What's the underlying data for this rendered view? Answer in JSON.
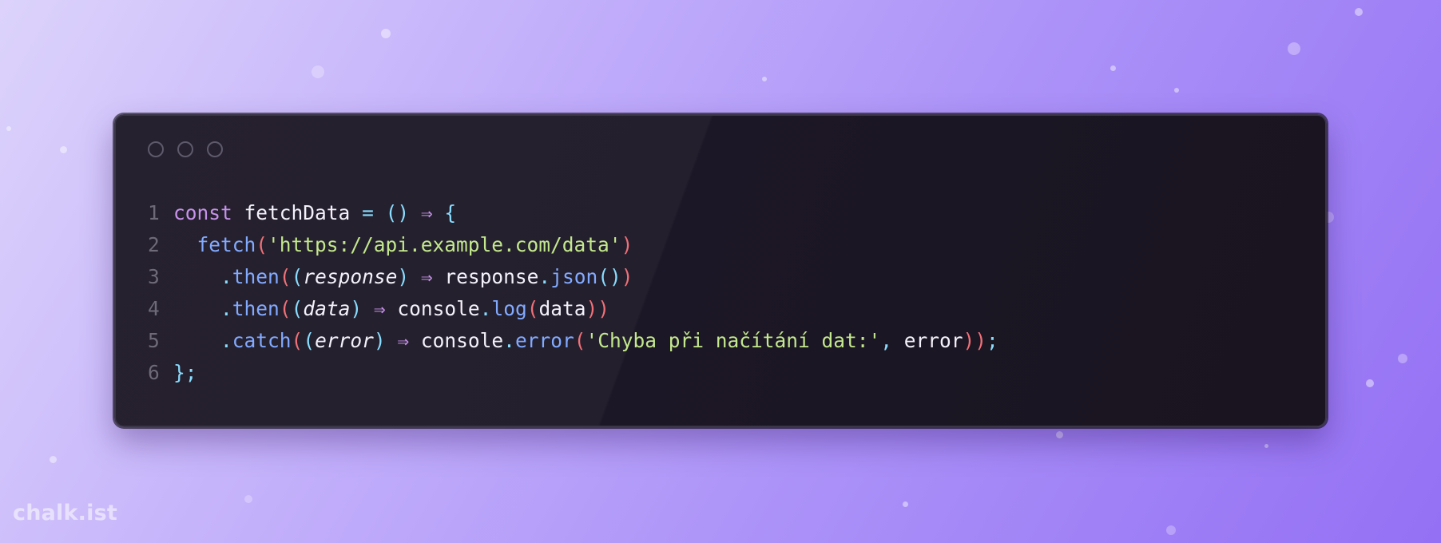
{
  "window": {
    "controls": [
      "window-dot",
      "window-dot",
      "window-dot"
    ]
  },
  "code": {
    "lines": [
      {
        "number": "1",
        "tokens": [
          {
            "t": "const",
            "c": "kw"
          },
          {
            "t": " ",
            "c": "id"
          },
          {
            "t": "fetchData",
            "c": "id"
          },
          {
            "t": " ",
            "c": "id"
          },
          {
            "t": "=",
            "c": "op"
          },
          {
            "t": " ",
            "c": "id"
          },
          {
            "t": "()",
            "c": "op"
          },
          {
            "t": " ",
            "c": "id"
          },
          {
            "t": "⇒",
            "c": "ar"
          },
          {
            "t": " ",
            "c": "id"
          },
          {
            "t": "{",
            "c": "op"
          }
        ]
      },
      {
        "number": "2",
        "tokens": [
          {
            "t": "  ",
            "c": "id"
          },
          {
            "t": "fetch",
            "c": "fn"
          },
          {
            "t": "(",
            "c": "pr"
          },
          {
            "t": "'https://api.example.com/data'",
            "c": "st"
          },
          {
            "t": ")",
            "c": "pr"
          }
        ]
      },
      {
        "number": "3",
        "tokens": [
          {
            "t": "    ",
            "c": "id"
          },
          {
            "t": ".",
            "c": "op"
          },
          {
            "t": "then",
            "c": "fn"
          },
          {
            "t": "(",
            "c": "pr"
          },
          {
            "t": "(",
            "c": "op"
          },
          {
            "t": "response",
            "c": "it"
          },
          {
            "t": ")",
            "c": "op"
          },
          {
            "t": " ",
            "c": "id"
          },
          {
            "t": "⇒",
            "c": "ar"
          },
          {
            "t": " ",
            "c": "id"
          },
          {
            "t": "response",
            "c": "id"
          },
          {
            "t": ".",
            "c": "op"
          },
          {
            "t": "json",
            "c": "fn"
          },
          {
            "t": "()",
            "c": "op"
          },
          {
            "t": ")",
            "c": "pr"
          }
        ]
      },
      {
        "number": "4",
        "tokens": [
          {
            "t": "    ",
            "c": "id"
          },
          {
            "t": ".",
            "c": "op"
          },
          {
            "t": "then",
            "c": "fn"
          },
          {
            "t": "(",
            "c": "pr"
          },
          {
            "t": "(",
            "c": "op"
          },
          {
            "t": "data",
            "c": "it"
          },
          {
            "t": ")",
            "c": "op"
          },
          {
            "t": " ",
            "c": "id"
          },
          {
            "t": "⇒",
            "c": "ar"
          },
          {
            "t": " ",
            "c": "id"
          },
          {
            "t": "console",
            "c": "id"
          },
          {
            "t": ".",
            "c": "op"
          },
          {
            "t": "log",
            "c": "fn"
          },
          {
            "t": "(",
            "c": "pr"
          },
          {
            "t": "data",
            "c": "id"
          },
          {
            "t": "))",
            "c": "pr"
          }
        ]
      },
      {
        "number": "5",
        "tokens": [
          {
            "t": "    ",
            "c": "id"
          },
          {
            "t": ".",
            "c": "op"
          },
          {
            "t": "catch",
            "c": "fn"
          },
          {
            "t": "(",
            "c": "pr"
          },
          {
            "t": "(",
            "c": "op"
          },
          {
            "t": "error",
            "c": "it"
          },
          {
            "t": ")",
            "c": "op"
          },
          {
            "t": " ",
            "c": "id"
          },
          {
            "t": "⇒",
            "c": "ar"
          },
          {
            "t": " ",
            "c": "id"
          },
          {
            "t": "console",
            "c": "id"
          },
          {
            "t": ".",
            "c": "op"
          },
          {
            "t": "error",
            "c": "fn"
          },
          {
            "t": "(",
            "c": "pr"
          },
          {
            "t": "'Chyba při načítání dat:'",
            "c": "st"
          },
          {
            "t": ",",
            "c": "op"
          },
          {
            "t": " error",
            "c": "id"
          },
          {
            "t": "))",
            "c": "pr"
          },
          {
            "t": ";",
            "c": "op"
          }
        ]
      },
      {
        "number": "6",
        "tokens": [
          {
            "t": "};",
            "c": "op"
          }
        ]
      }
    ]
  },
  "colors": {
    "keyword": "#c792ea",
    "function": "#82aaff",
    "string": "#c3e88d",
    "paren": "#f07178",
    "operator": "#89ddff",
    "identifier": "#f4f1fa",
    "line_number": "#6e6a78"
  },
  "watermark": {
    "text": "chalk.ist"
  }
}
